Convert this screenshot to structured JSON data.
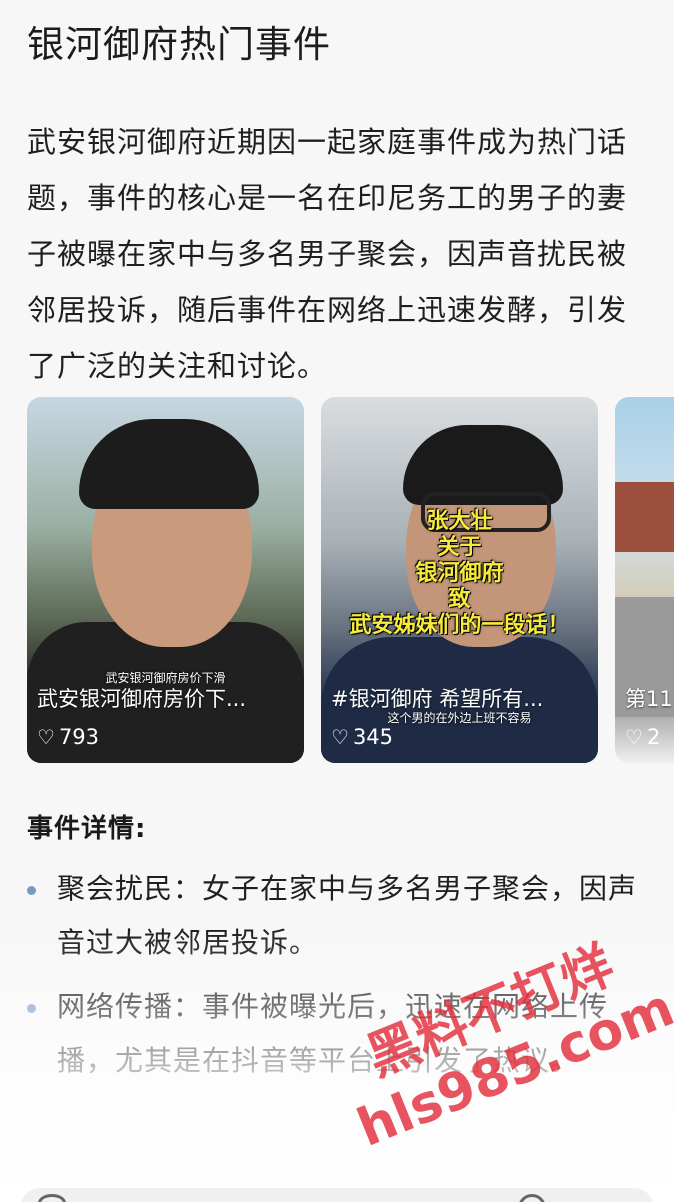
{
  "article": {
    "title": "银河御府热门事件",
    "intro": "武安银河御府近期因一起家庭事件成为热门话题，事件的核心是一名在印尼务工的男子的妻子被曝在家中与多名男子聚会，因声音扰民被邻居投诉，随后事件在网络上迅速发酵，引发了广泛的关注和讨论。"
  },
  "videos": [
    {
      "title": "武安银河御府房价下...",
      "likes": "793",
      "overlay_caption": "武安银河御府房价下滑"
    },
    {
      "title": "#银河御府 希望所有...",
      "likes": "345",
      "overlay_caption": "这个男的在外边上班不容易",
      "overlay_lines": [
        "张大壮",
        "关于",
        "银河御府",
        "致",
        "武安姊妹们的一段话！"
      ]
    },
    {
      "title": "第11",
      "likes": "2"
    }
  ],
  "details": {
    "heading": "事件详情:",
    "items": [
      "聚会扰民：女子在家中与多名男子聚会，因声音过大被邻居投诉。",
      "网络传播：事件被曝光后，迅速在网络上传播，尤其是在抖音等平台上引发了热议。"
    ]
  },
  "watermark": {
    "line1": "黑料不打烊",
    "line2": "hls985.com"
  },
  "colors": {
    "bullet": "#7a99c8",
    "watermark": "#e22e3c",
    "overlay_yellow": "#f7ec3c"
  },
  "icons": {
    "like": "heart-outline-icon"
  }
}
